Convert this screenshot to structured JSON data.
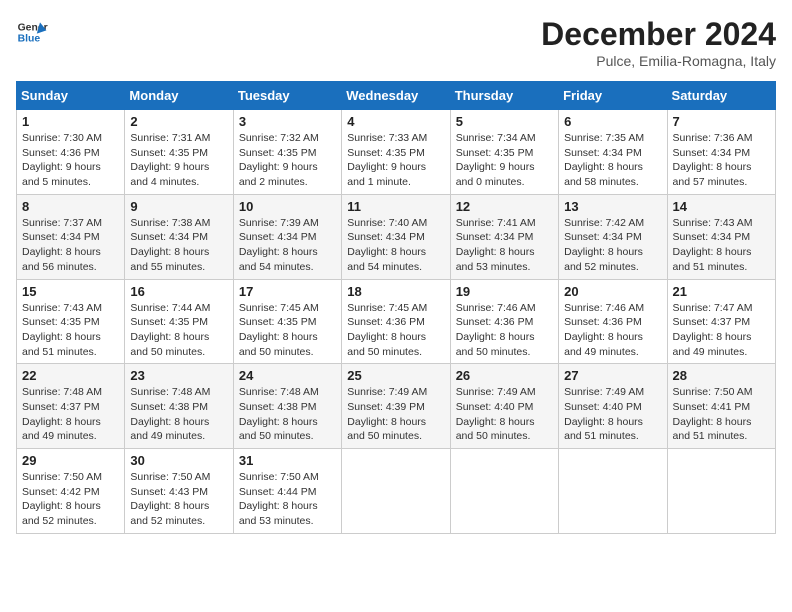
{
  "logo": {
    "line1": "General",
    "line2": "Blue"
  },
  "title": "December 2024",
  "location": "Pulce, Emilia-Romagna, Italy",
  "weekdays": [
    "Sunday",
    "Monday",
    "Tuesday",
    "Wednesday",
    "Thursday",
    "Friday",
    "Saturday"
  ],
  "weeks": [
    [
      {
        "day": "1",
        "detail": "Sunrise: 7:30 AM\nSunset: 4:36 PM\nDaylight: 9 hours\nand 5 minutes."
      },
      {
        "day": "2",
        "detail": "Sunrise: 7:31 AM\nSunset: 4:35 PM\nDaylight: 9 hours\nand 4 minutes."
      },
      {
        "day": "3",
        "detail": "Sunrise: 7:32 AM\nSunset: 4:35 PM\nDaylight: 9 hours\nand 2 minutes."
      },
      {
        "day": "4",
        "detail": "Sunrise: 7:33 AM\nSunset: 4:35 PM\nDaylight: 9 hours\nand 1 minute."
      },
      {
        "day": "5",
        "detail": "Sunrise: 7:34 AM\nSunset: 4:35 PM\nDaylight: 9 hours\nand 0 minutes."
      },
      {
        "day": "6",
        "detail": "Sunrise: 7:35 AM\nSunset: 4:34 PM\nDaylight: 8 hours\nand 58 minutes."
      },
      {
        "day": "7",
        "detail": "Sunrise: 7:36 AM\nSunset: 4:34 PM\nDaylight: 8 hours\nand 57 minutes."
      }
    ],
    [
      {
        "day": "8",
        "detail": "Sunrise: 7:37 AM\nSunset: 4:34 PM\nDaylight: 8 hours\nand 56 minutes."
      },
      {
        "day": "9",
        "detail": "Sunrise: 7:38 AM\nSunset: 4:34 PM\nDaylight: 8 hours\nand 55 minutes."
      },
      {
        "day": "10",
        "detail": "Sunrise: 7:39 AM\nSunset: 4:34 PM\nDaylight: 8 hours\nand 54 minutes."
      },
      {
        "day": "11",
        "detail": "Sunrise: 7:40 AM\nSunset: 4:34 PM\nDaylight: 8 hours\nand 54 minutes."
      },
      {
        "day": "12",
        "detail": "Sunrise: 7:41 AM\nSunset: 4:34 PM\nDaylight: 8 hours\nand 53 minutes."
      },
      {
        "day": "13",
        "detail": "Sunrise: 7:42 AM\nSunset: 4:34 PM\nDaylight: 8 hours\nand 52 minutes."
      },
      {
        "day": "14",
        "detail": "Sunrise: 7:43 AM\nSunset: 4:34 PM\nDaylight: 8 hours\nand 51 minutes."
      }
    ],
    [
      {
        "day": "15",
        "detail": "Sunrise: 7:43 AM\nSunset: 4:35 PM\nDaylight: 8 hours\nand 51 minutes."
      },
      {
        "day": "16",
        "detail": "Sunrise: 7:44 AM\nSunset: 4:35 PM\nDaylight: 8 hours\nand 50 minutes."
      },
      {
        "day": "17",
        "detail": "Sunrise: 7:45 AM\nSunset: 4:35 PM\nDaylight: 8 hours\nand 50 minutes."
      },
      {
        "day": "18",
        "detail": "Sunrise: 7:45 AM\nSunset: 4:36 PM\nDaylight: 8 hours\nand 50 minutes."
      },
      {
        "day": "19",
        "detail": "Sunrise: 7:46 AM\nSunset: 4:36 PM\nDaylight: 8 hours\nand 50 minutes."
      },
      {
        "day": "20",
        "detail": "Sunrise: 7:46 AM\nSunset: 4:36 PM\nDaylight: 8 hours\nand 49 minutes."
      },
      {
        "day": "21",
        "detail": "Sunrise: 7:47 AM\nSunset: 4:37 PM\nDaylight: 8 hours\nand 49 minutes."
      }
    ],
    [
      {
        "day": "22",
        "detail": "Sunrise: 7:48 AM\nSunset: 4:37 PM\nDaylight: 8 hours\nand 49 minutes."
      },
      {
        "day": "23",
        "detail": "Sunrise: 7:48 AM\nSunset: 4:38 PM\nDaylight: 8 hours\nand 49 minutes."
      },
      {
        "day": "24",
        "detail": "Sunrise: 7:48 AM\nSunset: 4:38 PM\nDaylight: 8 hours\nand 50 minutes."
      },
      {
        "day": "25",
        "detail": "Sunrise: 7:49 AM\nSunset: 4:39 PM\nDaylight: 8 hours\nand 50 minutes."
      },
      {
        "day": "26",
        "detail": "Sunrise: 7:49 AM\nSunset: 4:40 PM\nDaylight: 8 hours\nand 50 minutes."
      },
      {
        "day": "27",
        "detail": "Sunrise: 7:49 AM\nSunset: 4:40 PM\nDaylight: 8 hours\nand 51 minutes."
      },
      {
        "day": "28",
        "detail": "Sunrise: 7:50 AM\nSunset: 4:41 PM\nDaylight: 8 hours\nand 51 minutes."
      }
    ],
    [
      {
        "day": "29",
        "detail": "Sunrise: 7:50 AM\nSunset: 4:42 PM\nDaylight: 8 hours\nand 52 minutes."
      },
      {
        "day": "30",
        "detail": "Sunrise: 7:50 AM\nSunset: 4:43 PM\nDaylight: 8 hours\nand 52 minutes."
      },
      {
        "day": "31",
        "detail": "Sunrise: 7:50 AM\nSunset: 4:44 PM\nDaylight: 8 hours\nand 53 minutes."
      },
      {
        "day": "",
        "detail": ""
      },
      {
        "day": "",
        "detail": ""
      },
      {
        "day": "",
        "detail": ""
      },
      {
        "day": "",
        "detail": ""
      }
    ]
  ]
}
